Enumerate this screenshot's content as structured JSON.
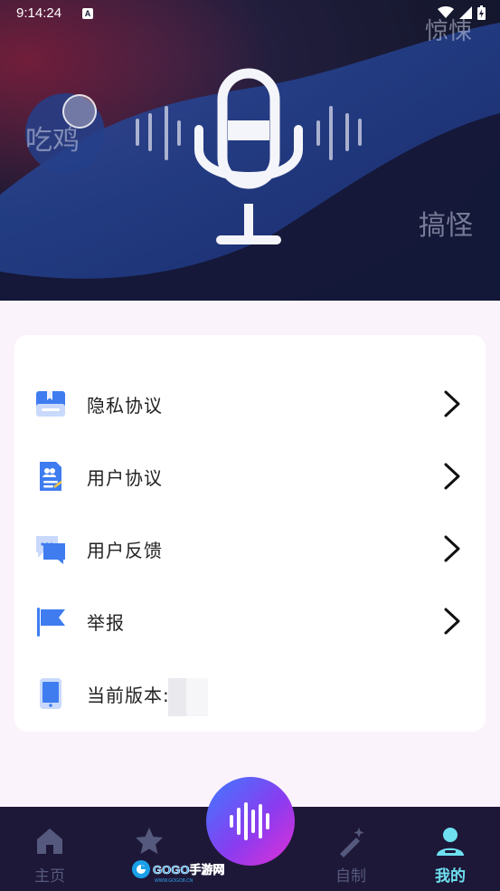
{
  "status_bar": {
    "time": "9:14:24",
    "badge": "A"
  },
  "banner": {
    "words": [
      "吃鸡",
      "惊悚",
      "搞怪"
    ]
  },
  "menu": {
    "items": [
      {
        "label": "隐私协议",
        "icon": "privacy-book-icon"
      },
      {
        "label": "用户协议",
        "icon": "user-agreement-doc-icon"
      },
      {
        "label": "用户反馈",
        "icon": "feedback-chat-icon"
      },
      {
        "label": "举报",
        "icon": "report-flag-icon"
      }
    ],
    "version_label": "当前版本:"
  },
  "tabs": [
    {
      "label": "主页",
      "icon": "home-icon"
    },
    {
      "label": "",
      "icon": "star-icon"
    },
    {
      "label": "自制",
      "icon": "magic-wand-icon"
    },
    {
      "label": "我的",
      "icon": "profile-icon"
    }
  ],
  "watermark": {
    "text": "GOGO手游网",
    "sub": "WWW.GOGO8.CN"
  },
  "colors": {
    "accent_active": "#6ee0f0",
    "tabbar_bg": "#1e1838",
    "icon_blue": "#3e7cf0"
  }
}
